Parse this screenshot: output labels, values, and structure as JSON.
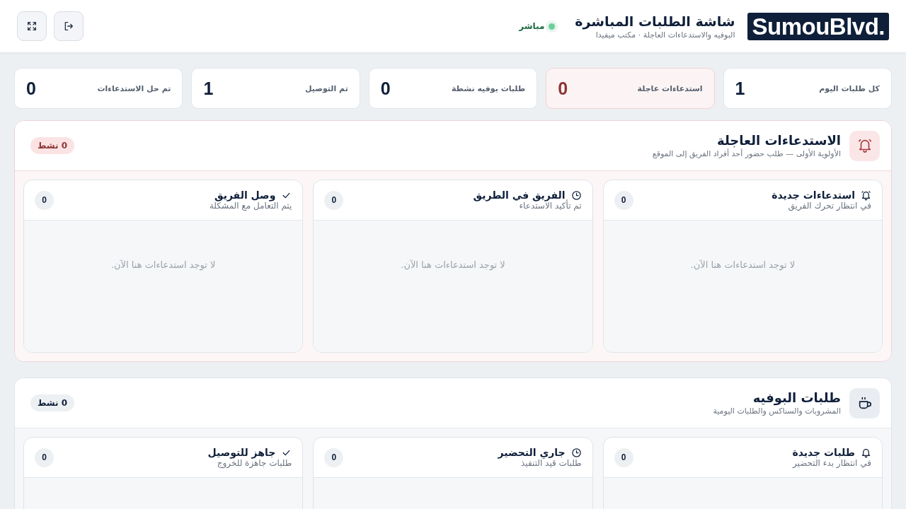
{
  "header": {
    "logo": "SumouBlvd.",
    "title": "شاشة الطلبات المباشرة",
    "subtitle": "البوفيه والاستدعاءات العاجلة · مكتب ميفيدا",
    "status": {
      "label": "مباشر",
      "on": true
    },
    "buttons": [
      {
        "kind": "fullscreen"
      },
      {
        "kind": "logout"
      }
    ]
  },
  "stats": [
    {
      "label": "كل طلبات اليوم",
      "value": "1",
      "kind": "normal"
    },
    {
      "label": "استدعاءات عاجلة",
      "value": "0",
      "kind": "alert"
    },
    {
      "label": "طلبات بوفيه نشطة",
      "value": "0",
      "kind": "normal"
    },
    {
      "label": "تم التوصيل",
      "value": "1",
      "kind": "normal"
    },
    {
      "label": "تم حل الاستدعاءات",
      "value": "0",
      "kind": "normal"
    }
  ],
  "sections": [
    {
      "kind": "urgent",
      "title": "الاستدعاءات العاجلة",
      "subtitle": "الأولوية الأولى — طلب حضور أحد أفراد الفريق إلى الموقع",
      "badge": "0 نشط",
      "columns": [
        {
          "title": "استدعاءات جديدة",
          "subtitle": "في انتظار تحرك الفريق",
          "count": "0",
          "empty": "لا توجد استدعاءات هنا الآن."
        },
        {
          "title": "الفريق في الطريق",
          "subtitle": "تم تأكيد الاستدعاء",
          "count": "0",
          "empty": "لا توجد استدعاءات هنا الآن."
        },
        {
          "title": "وصل الفريق",
          "subtitle": "يتم التعامل مع المشكلة",
          "count": "0",
          "empty": "لا توجد استدعاءات هنا الآن."
        }
      ]
    },
    {
      "kind": "normal",
      "title": "طلبات البوفيه",
      "subtitle": "المشروبات والسناكس والطلبات اليومية",
      "badge": "0 نشط",
      "columns": [
        {
          "title": "طلبات جديدة",
          "subtitle": "في انتظار بدء التحضير",
          "count": "0"
        },
        {
          "title": "جاري التحضير",
          "subtitle": "طلبات قيد التنفيذ",
          "count": "0"
        },
        {
          "title": "جاهز للتوصيل",
          "subtitle": "طلبات جاهزة للخروج",
          "count": "0"
        }
      ]
    }
  ]
}
